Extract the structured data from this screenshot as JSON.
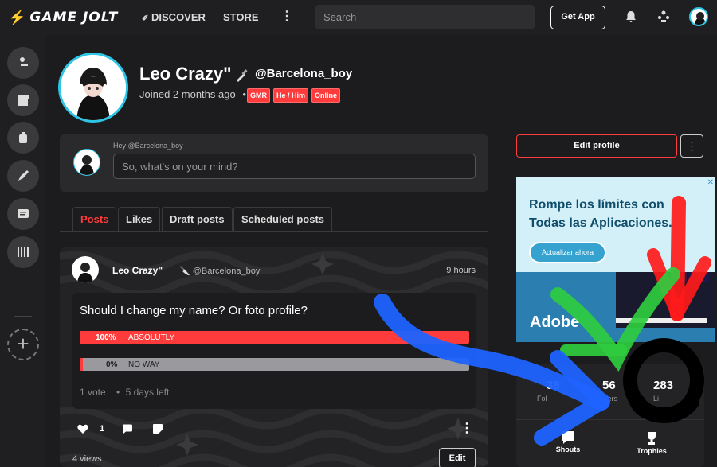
{
  "topbar": {
    "logo": "GAME JOLT",
    "nav": {
      "discover": "DISCOVER",
      "store": "STORE"
    },
    "search_placeholder": "Search",
    "get_app": "Get App"
  },
  "profile": {
    "name": "Leo Crazy\"",
    "handle": "@Barcelona_boy",
    "joined": "Joined 2 months ago",
    "separator": "•",
    "tags": [
      "GMR",
      "He / Him",
      "Online"
    ]
  },
  "composer": {
    "greeting": "Hey @Barcelona_boy",
    "placeholder": "So, what's on your mind?"
  },
  "tabs": [
    "Posts",
    "Likes",
    "Draft posts",
    "Scheduled posts"
  ],
  "post": {
    "author": "Leo Crazy\"",
    "handle": "@Barcelona_boy",
    "time": "9 hours",
    "poll": {
      "question": "Should I change my name? Or foto profile?",
      "options": [
        {
          "percent": "100%",
          "label": "ABSOLUTLY",
          "fraction": 1.0
        },
        {
          "percent": "0%",
          "label": "NO WAY",
          "fraction": 0.0
        }
      ],
      "votes": "1 vote",
      "bullet": "•",
      "remaining": "5 days left"
    },
    "likes": "1",
    "views": "4 views",
    "edit": "Edit"
  },
  "sidebar_right": {
    "edit_profile": "Edit profile",
    "ad": {
      "headline": "Rompe los límites con Todas las Aplicaciones.",
      "cta": "Actualizar ahora",
      "brand": "Adobe"
    },
    "stats": [
      {
        "num": "38",
        "label": "Fol"
      },
      {
        "num": "56",
        "label": "wers"
      },
      {
        "num": "283",
        "label": "Li"
      }
    ],
    "links": [
      "Shouts",
      "Trophies"
    ]
  },
  "colors": {
    "accent": "#ff3b3b",
    "ring": "#2ec6e6",
    "bg": "#1c1c1e",
    "card": "#232326"
  }
}
